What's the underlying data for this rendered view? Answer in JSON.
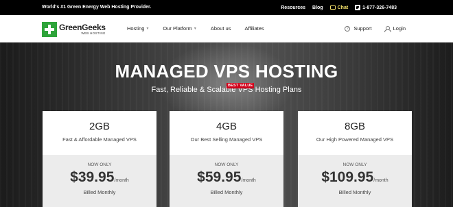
{
  "topbar": {
    "tagline": "World's #1 Green Energy Web Hosting Provider.",
    "resources": "Resources",
    "blog": "Blog",
    "chat": "Chat",
    "phone": "1-877-326-7483"
  },
  "navbar": {
    "logo_name": "GreenGeeks",
    "logo_sub": "WEB HOSTING",
    "links": [
      "Hosting",
      "Our Platform",
      "About us",
      "Affiliates"
    ],
    "support": "Support",
    "login": "Login"
  },
  "hero": {
    "title": "MANAGED VPS HOSTING",
    "subtitle": "Fast, Reliable & Scalable VPS Hosting Plans"
  },
  "plans": [
    {
      "name": "2GB",
      "desc": "Fast & Affordable Managed VPS",
      "now": "NOW ONLY",
      "price": "$39.95",
      "per": "/month",
      "billed": "Billed Monthly"
    },
    {
      "name": "4GB",
      "desc": "Our Best Selling Managed VPS",
      "now": "NOW ONLY",
      "price": "$59.95",
      "per": "/month",
      "billed": "Billed Monthly",
      "badge": "BEST VALUE"
    },
    {
      "name": "8GB",
      "desc": "Our High Powered Managed VPS",
      "now": "NOW ONLY",
      "price": "$109.95",
      "per": "/month",
      "billed": "Billed Monthly"
    }
  ],
  "colors": {
    "brand_green": "#2ea43a",
    "badge_red": "#d0021b",
    "chat_yellow": "#f6e36b"
  }
}
